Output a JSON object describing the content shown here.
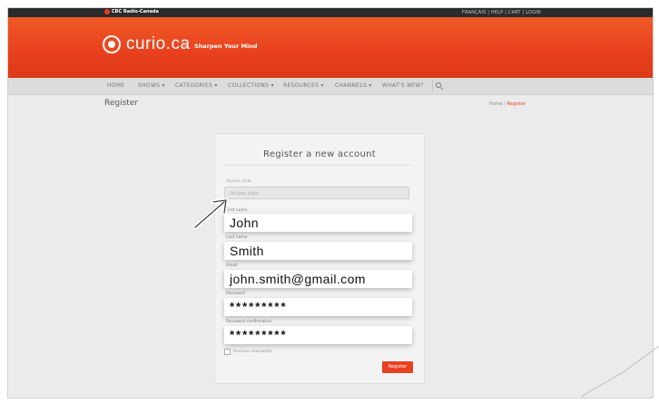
{
  "topbar": {
    "brand": "CBC Radio-Canada",
    "utility": "FRANÇAIS | HELP | CART | LOGIN"
  },
  "header": {
    "logo": "curio.ca",
    "separator": ">",
    "tagline": "Sharpen Your Mind"
  },
  "nav": {
    "items": [
      {
        "label": "HOME"
      },
      {
        "label": "SHOWS ▾"
      },
      {
        "label": "CATEGORIES ▾"
      },
      {
        "label": "COLLECTIONS ▾"
      },
      {
        "label": "RESOURCES ▾"
      },
      {
        "label": "CHANNELS ▾"
      },
      {
        "label": "WHAT'S NEW?"
      }
    ]
  },
  "page": {
    "title": "Register",
    "breadcrumb_home": "Home",
    "breadcrumb_sep": "/",
    "breadcrumb_current": "Register"
  },
  "form": {
    "title": "Register a new account",
    "access_code_label": "Access code",
    "access_code_placeholder": "Access code",
    "first_name_label": "First name",
    "first_name_value": "John",
    "last_name_label": "Last name",
    "last_name_value": "Smith",
    "email_label": "Email",
    "email_value": "john.smith@gmail.com",
    "password_label": "Password",
    "password_value": "*********",
    "password_confirm_label": "Password confirmation",
    "password_confirm_value": "*********",
    "newsletter_label": "Receive newsletter",
    "register_label": "Register"
  },
  "colors": {
    "brand_orange": "#e8401e",
    "topbar": "#2b2b2b"
  }
}
